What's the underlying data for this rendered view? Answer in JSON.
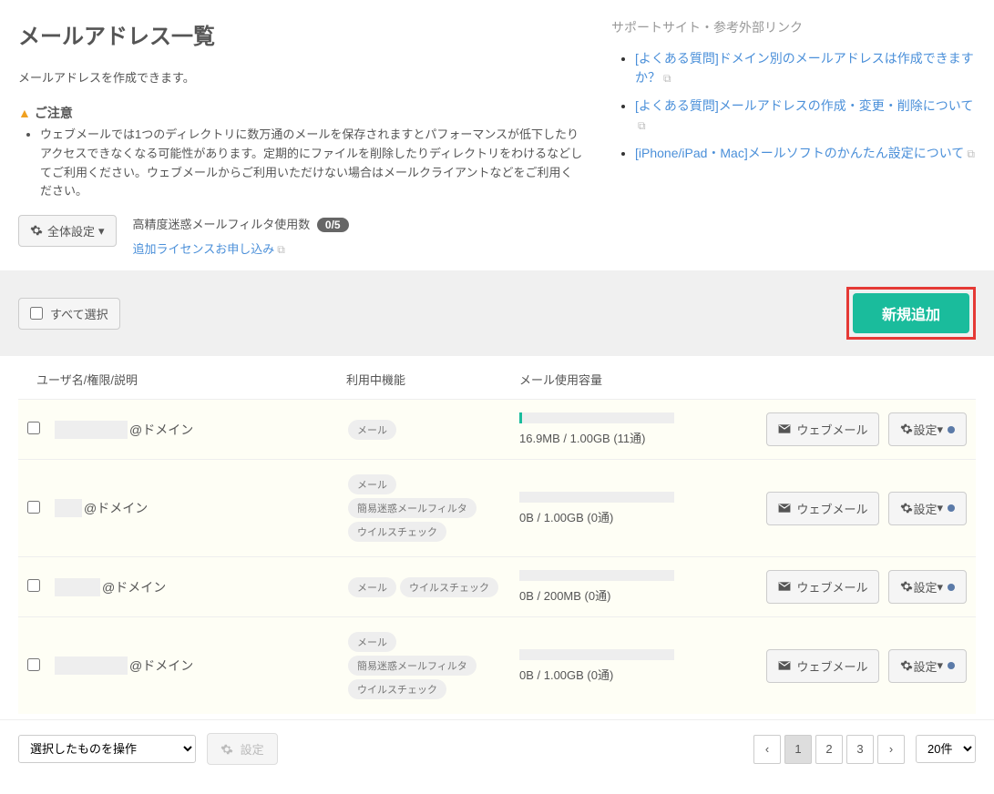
{
  "header": {
    "title": "メールアドレス一覧",
    "description": "メールアドレスを作成できます。",
    "warning_label": "ご注意",
    "warning_text": "ウェブメールでは1つのディレクトリに数万通のメールを保存されますとパフォーマンスが低下したりアクセスできなくなる可能性があります。定期的にファイルを削除したりディレクトリをわけるなどしてご利用ください。ウェブメールからご利用いただけない場合はメールクライアントなどをご利用ください。"
  },
  "support": {
    "title": "サポートサイト・参考外部リンク",
    "links": [
      "[よくある質問]ドメイン別のメールアドレスは作成できますか？",
      "[よくある質問]メールアドレスの作成・変更・削除について",
      "[iPhone/iPad・Mac]メールソフトのかんたん設定について"
    ]
  },
  "settings": {
    "global_btn": "全体設定",
    "filter_label": "高精度迷惑メールフィルタ使用数",
    "filter_count": "0/5",
    "license_link": "追加ライセンスお申し込み"
  },
  "toolbar": {
    "select_all": "すべて選択",
    "add_new": "新規追加"
  },
  "columns": {
    "user": "ユーザ名/権限/説明",
    "features": "利用中機能",
    "usage": "メール使用容量"
  },
  "tags": {
    "mail": "メール",
    "spam": "簡易迷惑メールフィルタ",
    "virus": "ウイルスチェック"
  },
  "actions": {
    "webmail": "ウェブメール",
    "settings": "設定"
  },
  "rows": [
    {
      "domain": "@ドメイン",
      "mask_w": 80,
      "features": [
        "mail"
      ],
      "usage": "16.9MB / 1.00GB (11通)",
      "fill": 2
    },
    {
      "domain": "@ドメイン",
      "mask_w": 30,
      "features": [
        "mail",
        "spam",
        "virus"
      ],
      "usage": "0B / 1.00GB (0通)",
      "fill": 0
    },
    {
      "domain": "@ドメイン",
      "mask_w": 50,
      "features": [
        "mail",
        "virus"
      ],
      "usage": "0B / 200MB (0通)",
      "fill": 0
    },
    {
      "domain": "@ドメイン",
      "mask_w": 80,
      "features": [
        "mail",
        "spam",
        "virus"
      ],
      "usage": "0B / 1.00GB (0通)",
      "fill": 0
    }
  ],
  "footer": {
    "bulk_placeholder": "選択したものを操作",
    "bulk_settings": "設定",
    "pages": [
      "1",
      "2",
      "3"
    ],
    "active_page": "1",
    "per_page": "20件"
  }
}
